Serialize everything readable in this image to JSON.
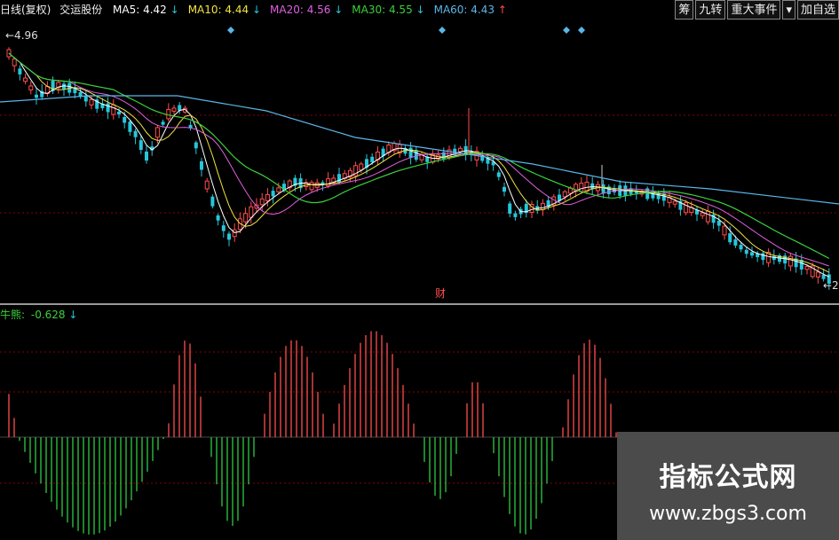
{
  "header": {
    "period": "日线(复权)",
    "stock_name": "交运股份",
    "ma": [
      {
        "label": "MA5:",
        "value": "4.42",
        "dir": "down",
        "color": "#ffffff"
      },
      {
        "label": "MA10:",
        "value": "4.44",
        "dir": "down",
        "color": "#f0e442"
      },
      {
        "label": "MA20:",
        "value": "4.56",
        "dir": "down",
        "color": "#e060e0"
      },
      {
        "label": "MA30:",
        "value": "4.55",
        "dir": "down",
        "color": "#3cd03c"
      },
      {
        "label": "MA60:",
        "value": "4.43",
        "dir": "up",
        "color": "#5bb6e8"
      }
    ]
  },
  "toolbar": {
    "btn1": "筹",
    "btn2": "九转",
    "btn3": "重大事件",
    "btn4": "▾",
    "btn5": "加自选"
  },
  "price_labels": {
    "high": "←4.96",
    "low": "←2",
    "event": "财"
  },
  "sub_chart": {
    "label": "牛熊:",
    "value": "-0.628",
    "dir": "down"
  },
  "watermark": {
    "title": "指标公式网",
    "url": "www.zbgs3.com"
  },
  "colors": {
    "up": "#ff4d4d",
    "down": "#26c6da",
    "hist_pos": "#ff4d4d",
    "hist_neg": "#2ecc40",
    "grid": "#8b0000",
    "marker": "#5bb6e8"
  }
}
